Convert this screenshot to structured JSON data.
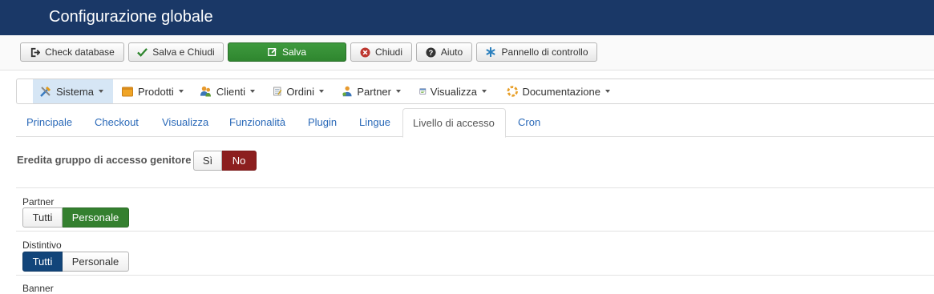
{
  "header": {
    "title": "Configurazione globale"
  },
  "toolbar": {
    "check_database": "Check database",
    "save_close": "Salva e Chiudi",
    "save": "Salva",
    "close": "Chiudi",
    "help": "Aiuto",
    "control_panel": "Pannello di controllo"
  },
  "menu": {
    "items": [
      {
        "label": "Sistema",
        "icon": "tools-icon"
      },
      {
        "label": "Prodotti",
        "icon": "box-icon"
      },
      {
        "label": "Clienti",
        "icon": "users-icon"
      },
      {
        "label": "Ordini",
        "icon": "orders-icon"
      },
      {
        "label": "Partner",
        "icon": "partner-icon"
      },
      {
        "label": "Visualizza",
        "icon": "display-icon"
      },
      {
        "label": "Documentazione",
        "icon": "help-icon"
      }
    ]
  },
  "tabs": [
    "Principale",
    "Checkout",
    "Visualizza",
    "Funzionalità",
    "Plugin",
    "Lingue",
    "Livello di accesso",
    "Cron"
  ],
  "active_tab": "Livello di accesso",
  "form": {
    "inherit": {
      "label": "Eredita gruppo di accesso genitore",
      "yes": "Sì",
      "no": "No",
      "selected": "No"
    },
    "partner": {
      "label": "Partner",
      "all": "Tutti",
      "personal": "Personale",
      "selected": "Personale"
    },
    "badge": {
      "label": "Distintivo",
      "all": "Tutti",
      "personal": "Personale",
      "selected": "Tutti"
    },
    "banner": {
      "label": "Banner"
    }
  },
  "colors": {
    "header_bg": "#1a3867",
    "save_green": "#2f862f",
    "no_red": "#8c1f1f",
    "selected_green": "#34802f",
    "selected_blue": "#12457a",
    "link_blue": "#2a69b8"
  }
}
